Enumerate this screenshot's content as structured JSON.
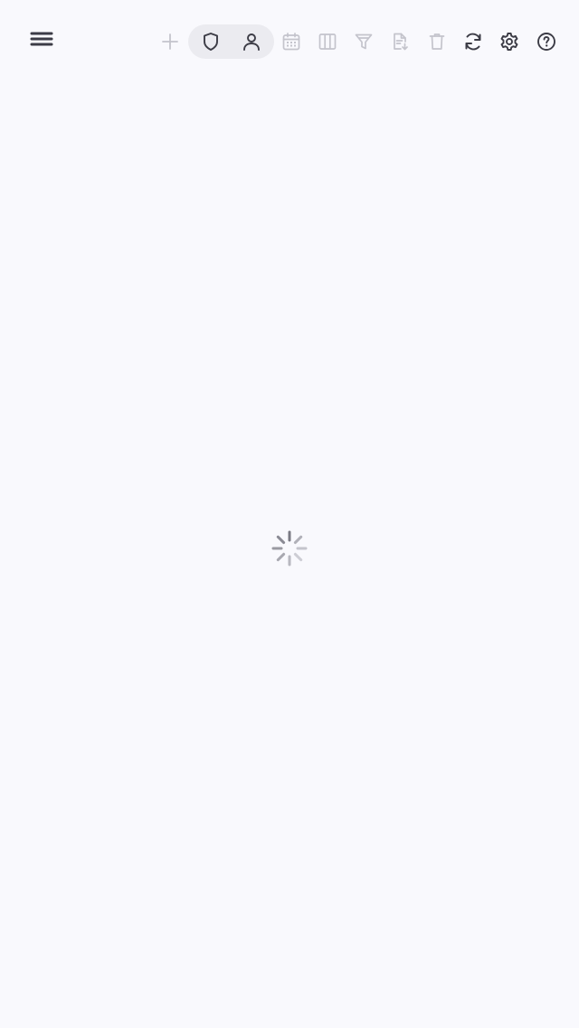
{
  "toolbar": {
    "menu_icon": "menu-icon",
    "left_actions": [
      {
        "name": "add-button",
        "icon": "plus-icon",
        "enabled": false
      }
    ],
    "view_toggle": [
      {
        "name": "shield-view-button",
        "icon": "shield-icon"
      },
      {
        "name": "person-view-button",
        "icon": "person-icon"
      }
    ],
    "actions": [
      {
        "name": "calendar-button",
        "icon": "calendar-icon",
        "enabled": false
      },
      {
        "name": "columns-button",
        "icon": "columns-icon",
        "enabled": false
      },
      {
        "name": "filter-button",
        "icon": "filter-icon",
        "enabled": false
      },
      {
        "name": "export-button",
        "icon": "document-export-icon",
        "enabled": false
      },
      {
        "name": "delete-button",
        "icon": "trash-icon",
        "enabled": false
      },
      {
        "name": "refresh-button",
        "icon": "refresh-icon",
        "enabled": true
      },
      {
        "name": "settings-button",
        "icon": "gear-icon",
        "enabled": true
      },
      {
        "name": "help-button",
        "icon": "help-circle-icon",
        "enabled": true
      }
    ]
  },
  "main": {
    "state": "loading",
    "spinner_icon": "loading-spinner-icon"
  },
  "colors": {
    "background": "#f9f9fd",
    "icon_active": "#3c3c46",
    "icon_disabled": "#c4c4cc",
    "segment_bg": "#ebebf0"
  }
}
